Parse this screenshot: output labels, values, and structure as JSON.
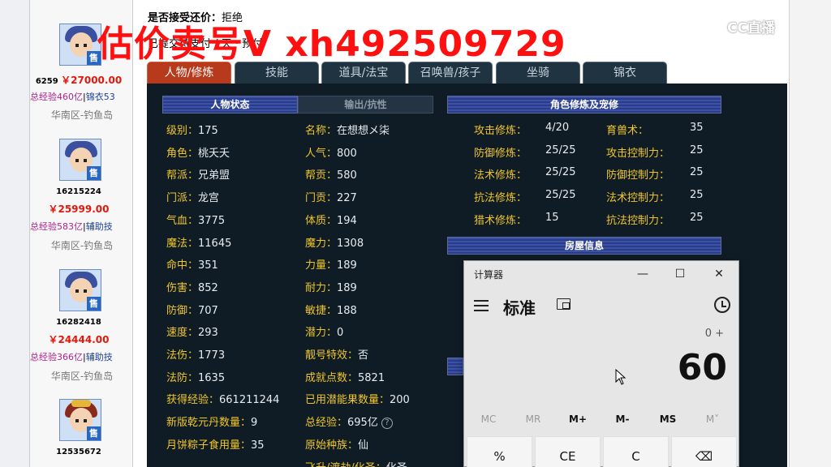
{
  "header": {
    "accept_offer_label": "是否接受还价：",
    "accept_offer_value": "拒绝",
    "line2": "已提交待支付 / 天 · 预付"
  },
  "watermark": "估价卖号V xh492509729",
  "cc_logo": "CC直播",
  "listings": [
    {
      "id": "6259",
      "price": "￥27000.00",
      "exp": "总经验460亿",
      "sep": "|",
      "tag": "锦衣53",
      "region": "华南区-钓鱼岛",
      "badge": "售"
    },
    {
      "id": "16215224",
      "price": "￥25999.00",
      "exp": "总经验583亿",
      "sep": "|",
      "tag": "辅助技",
      "region": "华南区-钓鱼岛",
      "badge": "售"
    },
    {
      "id": "16282418",
      "price": "￥24444.00",
      "exp": "总经验366亿",
      "sep": "|",
      "tag": "辅助技",
      "region": "华南区-钓鱼岛",
      "badge": "售"
    },
    {
      "id": "12535672",
      "price": "",
      "exp": "",
      "sep": "",
      "tag": "",
      "region": "",
      "badge": "售"
    }
  ],
  "tabs": [
    "人物/修炼",
    "技能",
    "道具/法宝",
    "召唤兽/孩子",
    "坐骑",
    "锦衣"
  ],
  "sections": {
    "char_status": "人物状态",
    "output_resist": "输出/抗性",
    "cultivation": "角色修炼及宠修",
    "house": "房屋信息"
  },
  "left_stats": [
    {
      "k": "级别：",
      "v": "175"
    },
    {
      "k": "角色：",
      "v": "桃夭夭"
    },
    {
      "k": "帮派：",
      "v": "兄弟盟"
    },
    {
      "k": "门派：",
      "v": "龙宫"
    },
    {
      "k": "气血：",
      "v": "3775"
    },
    {
      "k": "魔法：",
      "v": "11645"
    },
    {
      "k": "命中：",
      "v": "351"
    },
    {
      "k": "伤害：",
      "v": "852"
    },
    {
      "k": "防御：",
      "v": "707"
    },
    {
      "k": "速度：",
      "v": "293"
    },
    {
      "k": "法伤：",
      "v": "1773"
    },
    {
      "k": "法防：",
      "v": "1635"
    },
    {
      "k": "获得经验：",
      "v": "661211244"
    },
    {
      "k": "新版乾元丹数量：",
      "v": "9"
    },
    {
      "k": "月饼粽子食用量：",
      "v": "35"
    }
  ],
  "mid_stats": [
    {
      "k": "名称：",
      "v": "在想想メ柒"
    },
    {
      "k": "人气：",
      "v": "800"
    },
    {
      "k": "帮贡：",
      "v": "580"
    },
    {
      "k": "门贡：",
      "v": "227"
    },
    {
      "k": "体质：",
      "v": "194"
    },
    {
      "k": "魔力：",
      "v": "1308"
    },
    {
      "k": "力量：",
      "v": "189"
    },
    {
      "k": "耐力：",
      "v": "189"
    },
    {
      "k": "敏捷：",
      "v": "188"
    },
    {
      "k": "潜力：",
      "v": "0"
    },
    {
      "k": "靓号特效：",
      "v": "否"
    },
    {
      "k": "成就点数：",
      "v": "5821"
    },
    {
      "k": "已用潜能果数量：",
      "v": "200"
    },
    {
      "k": "总经验：",
      "v": "695亿"
    },
    {
      "k": "原始种族：",
      "v": "仙"
    },
    {
      "k": "飞升/渡劫/化圣：",
      "v": "化圣"
    }
  ],
  "cultivation_left": [
    {
      "k": "攻击修炼：",
      "v": "4/20"
    },
    {
      "k": "防御修炼：",
      "v": "25/25"
    },
    {
      "k": "法术修炼：",
      "v": "25/25"
    },
    {
      "k": "抗法修炼：",
      "v": "25/25"
    },
    {
      "k": "猎术修炼：",
      "v": "15"
    }
  ],
  "cultivation_right": [
    {
      "k": "育兽术：",
      "v": "35"
    },
    {
      "k": "攻击控制力：",
      "v": "25"
    },
    {
      "k": "防御控制力：",
      "v": "25"
    },
    {
      "k": "法术控制力：",
      "v": "25"
    },
    {
      "k": "抗法控制力：",
      "v": "25"
    }
  ],
  "calculator": {
    "title": "计算器",
    "mode": "标准",
    "expression": "0 +",
    "display": "60",
    "memory": [
      "MC",
      "MR",
      "M+",
      "M-",
      "MS",
      "M˅"
    ],
    "keys": [
      "%",
      "CE",
      "C",
      "⌫"
    ]
  }
}
